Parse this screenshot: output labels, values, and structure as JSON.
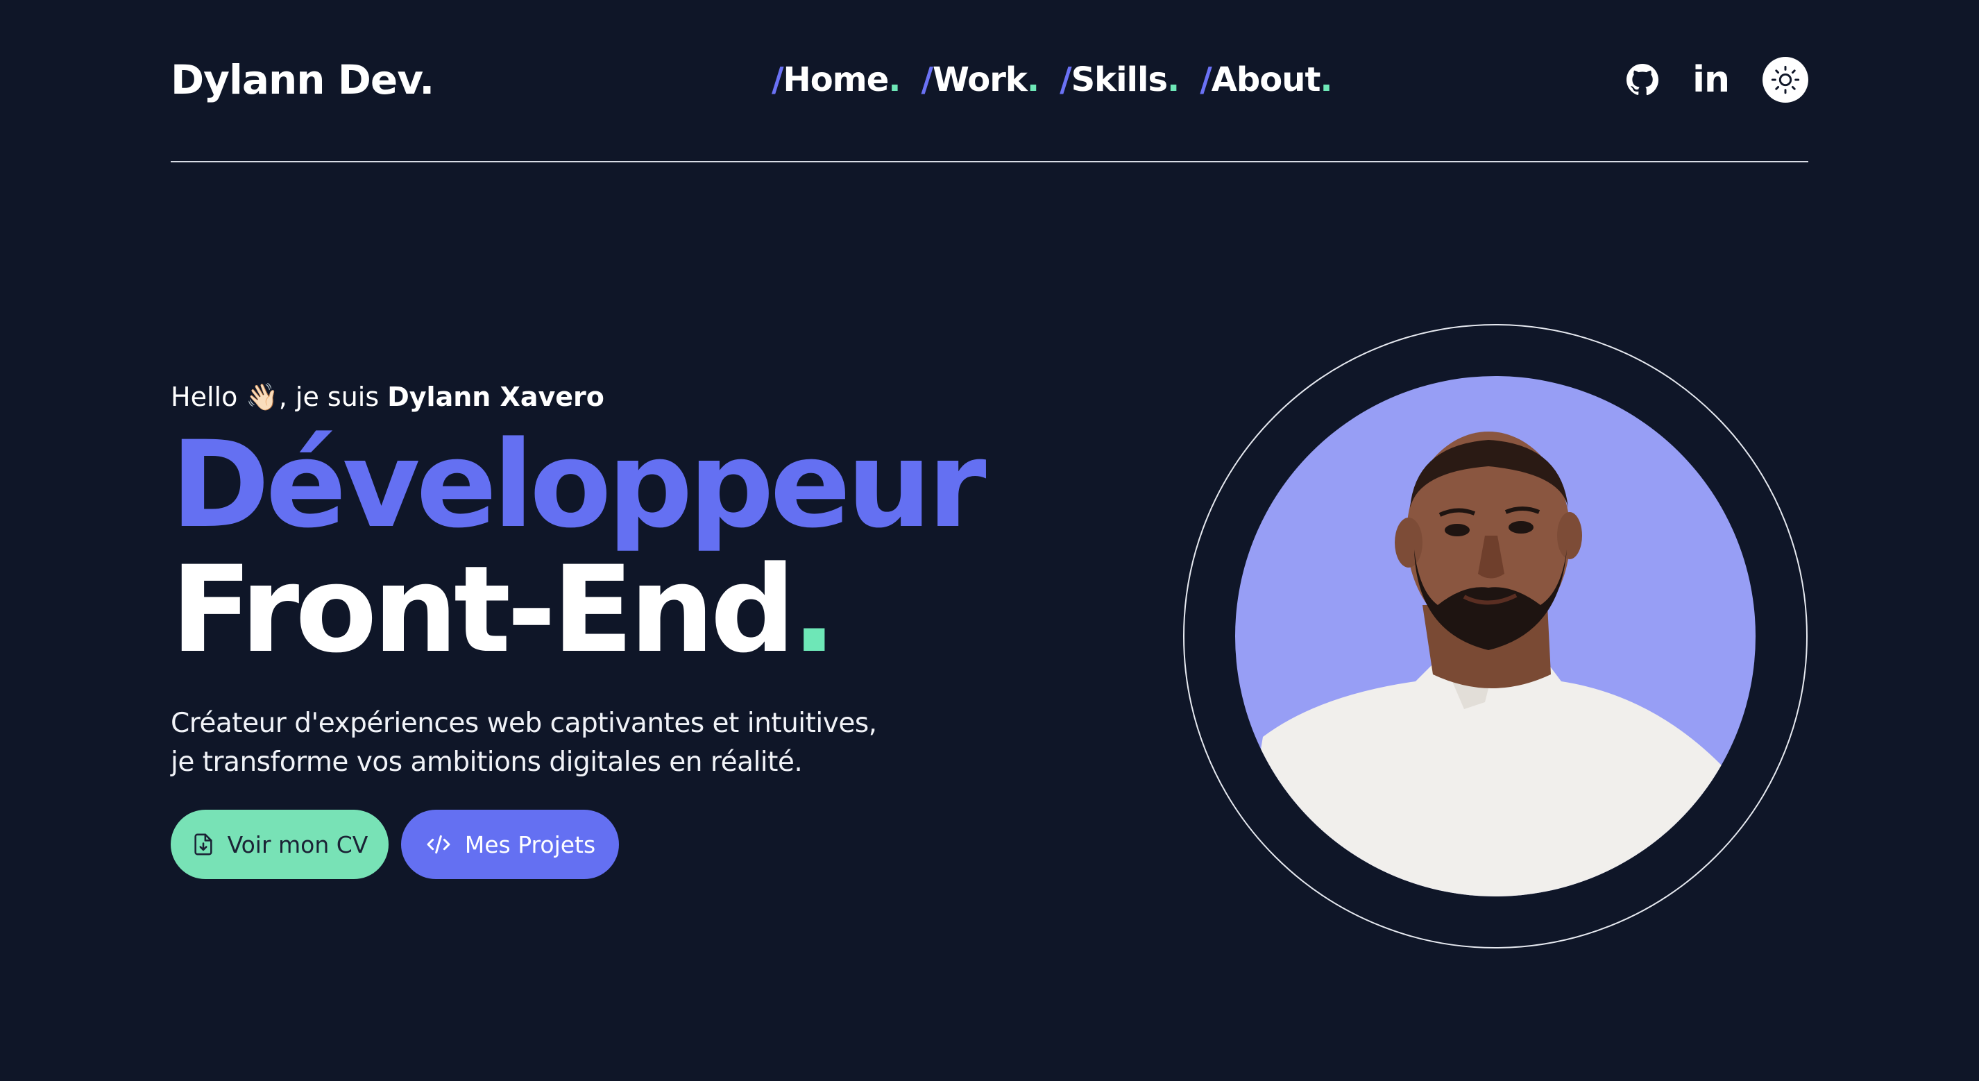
{
  "header": {
    "brand": "Dylann Dev.",
    "nav": [
      {
        "slash": "/",
        "label": "Home",
        "dot": "."
      },
      {
        "slash": "/",
        "label": "Work",
        "dot": "."
      },
      {
        "slash": "/",
        "label": "Skills",
        "dot": "."
      },
      {
        "slash": "/",
        "label": "About",
        "dot": "."
      }
    ],
    "linkedin_label": "in"
  },
  "hero": {
    "greeting_prefix": "Hello ",
    "greeting_emoji": "👋🏻",
    "greeting_middle": ", je suis ",
    "greeting_name": "Dylann Xavero",
    "title_line1": "Développeur",
    "title_line2": "Front-End",
    "title_dot": ".",
    "description_line1": "Créateur d'expériences web captivantes et intuitives,",
    "description_line2": "je transforme vos ambitions digitales en réalité.",
    "cv_button": "Voir mon CV",
    "projects_button": "Mes Projets"
  },
  "icons": {
    "github": "github-icon",
    "linkedin": "linkedin-icon",
    "theme": "sun-icon",
    "download": "download-file-icon",
    "code": "code-icon"
  },
  "colors": {
    "background": "#0f1628",
    "accent_blue": "#6470f2",
    "accent_green": "#6ee7b7",
    "portrait_bg": "#979ef5"
  }
}
